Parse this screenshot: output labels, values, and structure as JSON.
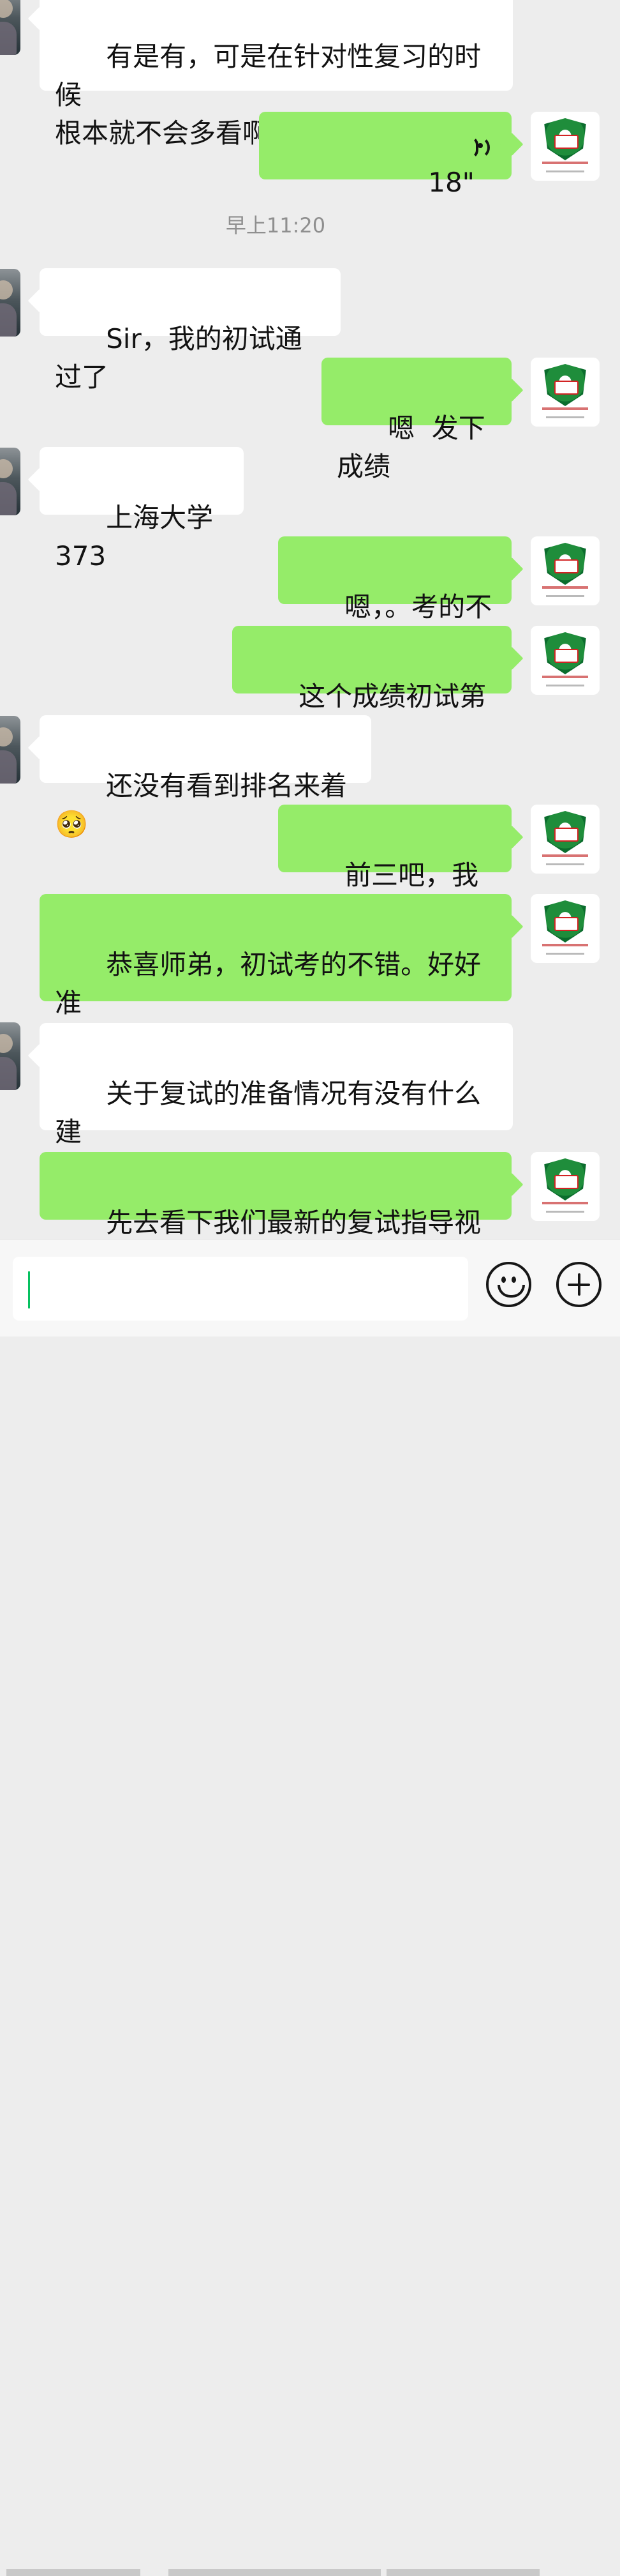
{
  "chat": {
    "time_divider": "早上11:20",
    "messages": [
      {
        "id": "m1",
        "side": "left",
        "text": "有是有，可是在针对性复习的时候\n根本就不会多看啊😂"
      },
      {
        "id": "m2",
        "side": "right",
        "type": "voice",
        "duration": "18\""
      },
      {
        "id": "m3",
        "side": "left",
        "text": "Sir，我的初试通过了"
      },
      {
        "id": "m4",
        "side": "right",
        "text": "嗯  发下成绩"
      },
      {
        "id": "m5",
        "side": "left",
        "text": "上海大学 373"
      },
      {
        "id": "m6",
        "side": "right",
        "text": "嗯，。考的不错"
      },
      {
        "id": "m7",
        "side": "right",
        "text": "这个成绩初试第几？"
      },
      {
        "id": "m8",
        "side": "left",
        "text": "还没有看到排名来着🥺"
      },
      {
        "id": "m9",
        "side": "right",
        "text": "前三吧，我感觉"
      },
      {
        "id": "m10",
        "side": "right",
        "text": "恭喜师弟，初试考的不错。好好准\n备复试吧。🌹"
      },
      {
        "id": "m11",
        "side": "left",
        "text": "关于复试的准备情况有没有什么建\n议呀？"
      },
      {
        "id": "m12",
        "side": "right",
        "text": "先去看下我们最新的复试指导视频"
      }
    ]
  },
  "input_bar": {
    "input_value": "",
    "emoji_icon": "emoji-icon",
    "plus_icon": "plus-icon"
  },
  "colors": {
    "background": "#ededed",
    "incoming_bubble": "#ffffff",
    "outgoing_bubble": "#95ec69",
    "timestamp": "#8f8f8f"
  }
}
